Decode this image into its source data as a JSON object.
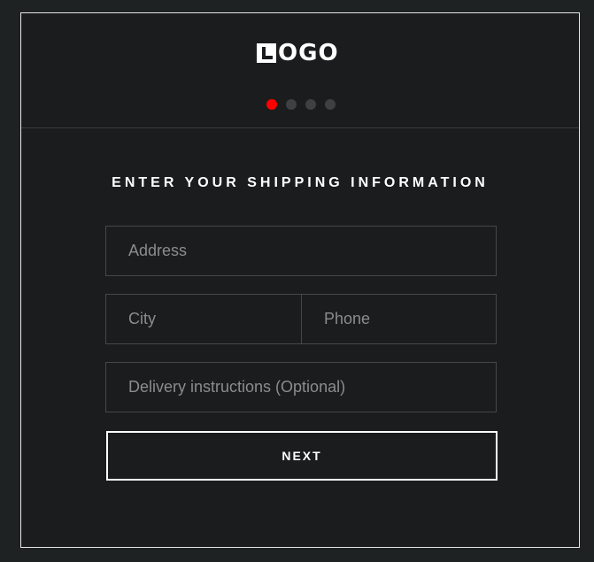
{
  "logo": {
    "mark": "L",
    "text": "OGO"
  },
  "progress": {
    "total_steps": 4,
    "current_step": 1,
    "active_color": "#ff0000",
    "inactive_color": "#3e4041"
  },
  "form": {
    "title": "ENTER YOUR SHIPPING INFORMATION",
    "address": {
      "placeholder": "Address",
      "value": ""
    },
    "city": {
      "placeholder": "City",
      "value": ""
    },
    "phone": {
      "placeholder": "Phone",
      "value": ""
    },
    "instructions": {
      "placeholder": "Delivery instructions (Optional)",
      "value": ""
    },
    "next_label": "NEXT"
  }
}
